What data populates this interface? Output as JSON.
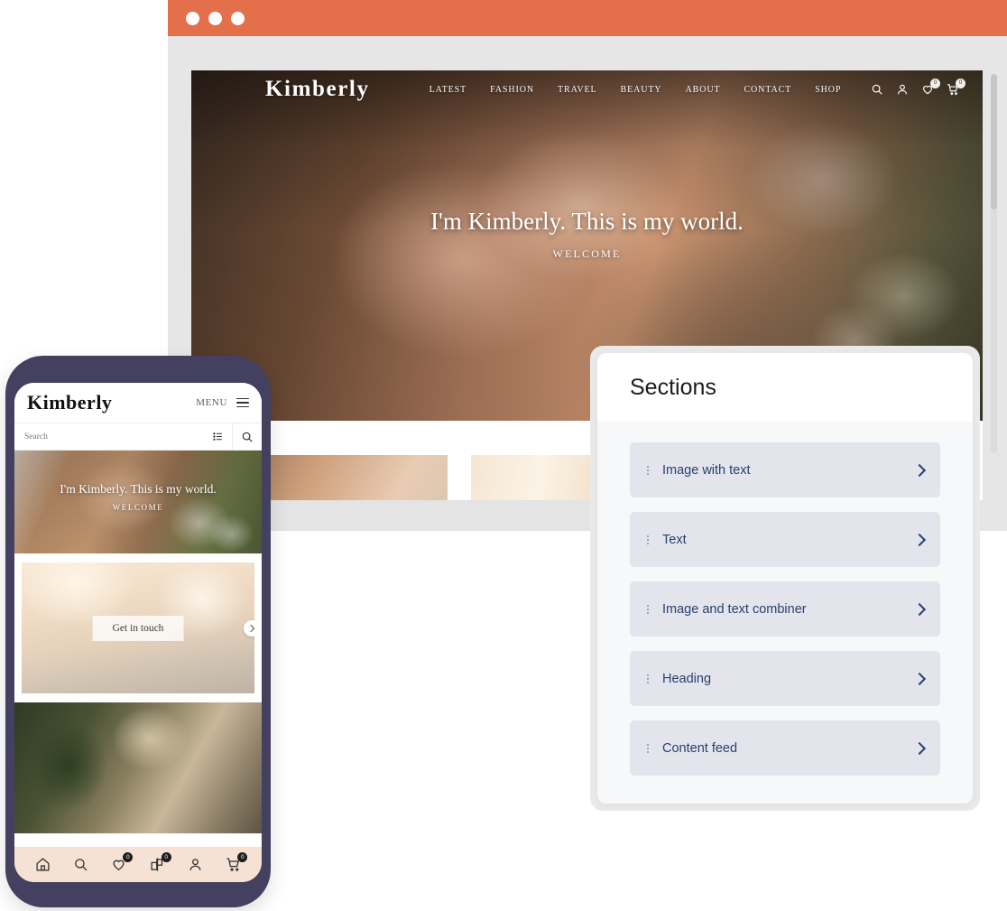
{
  "browser": {
    "traffic_lights": [
      "close",
      "minimize",
      "maximize"
    ],
    "chrome_color": "#e3704a",
    "background_color": "#e6e6e6"
  },
  "site": {
    "brand": "Kimberly",
    "nav": [
      {
        "label": "LATEST"
      },
      {
        "label": "FASHION"
      },
      {
        "label": "TRAVEL"
      },
      {
        "label": "BEAUTY"
      },
      {
        "label": "ABOUT"
      },
      {
        "label": "CONTACT"
      },
      {
        "label": "SHOP"
      }
    ],
    "icons": [
      {
        "name": "search-icon",
        "badge": null
      },
      {
        "name": "account-icon",
        "badge": null
      },
      {
        "name": "wishlist-icon",
        "badge": "0"
      },
      {
        "name": "cart-icon",
        "badge": "0"
      }
    ],
    "hero": {
      "title": "I'm Kimberly. This is my world.",
      "subtitle": "WELCOME"
    }
  },
  "panel": {
    "title": "Sections",
    "items": [
      {
        "label": "Image with text"
      },
      {
        "label": "Text"
      },
      {
        "label": "Image and text combiner"
      },
      {
        "label": "Heading"
      },
      {
        "label": "Content feed"
      }
    ],
    "item_bg": "#e4e5ec",
    "item_text_color": "#27406f"
  },
  "phone": {
    "frame_color": "#434060",
    "brand": "Kimberly",
    "menu_label": "MENU",
    "search_placeholder": "Search",
    "hero": {
      "title": "I'm Kimberly. This is my world.",
      "subtitle": "WELCOME"
    },
    "slide": {
      "button_label": "Get in touch"
    },
    "bottom_nav": [
      {
        "name": "home-icon",
        "badge": null
      },
      {
        "name": "search-icon",
        "badge": null
      },
      {
        "name": "wishlist-icon",
        "badge": "0"
      },
      {
        "name": "compare-icon",
        "badge": "0"
      },
      {
        "name": "account-icon",
        "badge": null
      },
      {
        "name": "cart-icon",
        "badge": "0"
      }
    ],
    "bottom_nav_bg": "#f6e1d5"
  }
}
